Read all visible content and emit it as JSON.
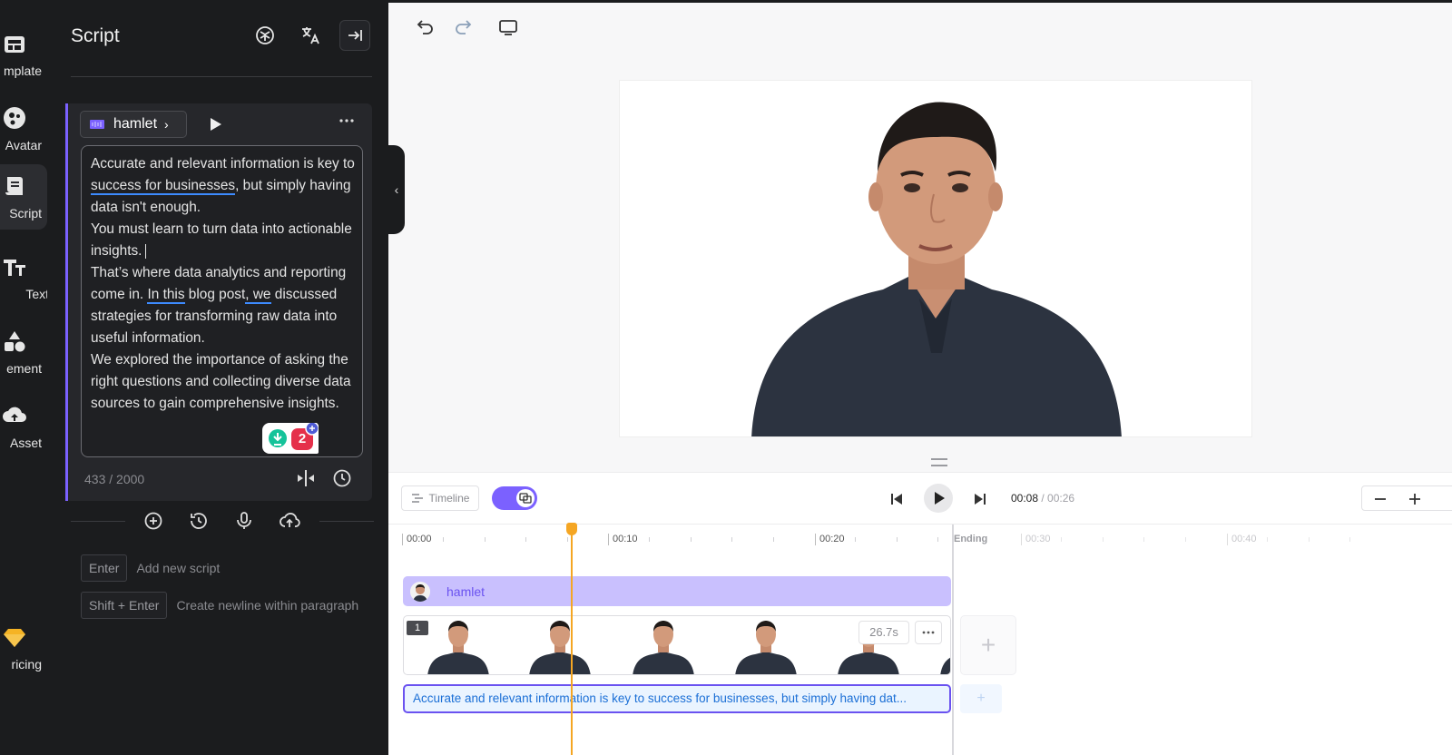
{
  "rail": {
    "items": [
      {
        "label": "mplate",
        "icon": "template-icon"
      },
      {
        "label": "Avatar",
        "icon": "avatar-icon"
      },
      {
        "label": "Script",
        "icon": "script-icon"
      },
      {
        "label": "Text",
        "icon": "text-icon"
      },
      {
        "label": "ement",
        "icon": "element-icon"
      },
      {
        "label": "Asset",
        "icon": "upload-cloud-icon"
      },
      {
        "label": "ricing",
        "icon": "diamond-icon"
      }
    ]
  },
  "panel": {
    "title": "Script",
    "voice_name": "hamlet",
    "script_text": {
      "p1a": "Accurate and relevant information is key to ",
      "p1u": "success for businesses",
      "p1b": ", but simply having data isn't enough.",
      "p2": "You must learn to turn data into actionable insights.",
      "p3a": "That’s where data analytics and reporting come in. ",
      "p3u1": "In this",
      "p3b": " blog post",
      "p3u2": ", we",
      "p3c": " discussed strategies for transforming raw data into useful information.",
      "p4": "We explored the importance of asking the right questions and collecting diverse data sources to gain comprehensive insights."
    },
    "grammar_count": "2",
    "char_count": "433 / 2000",
    "hints": [
      {
        "key": "Enter",
        "text": "Add new script"
      },
      {
        "key": "Shift + Enter",
        "text": "Create newline within paragraph"
      }
    ]
  },
  "timeline": {
    "mode_label": "Timeline",
    "current_time": "00:08",
    "total_time": " / 00:26",
    "ticks": [
      "00:00",
      "00:10",
      "00:20",
      "00:30",
      "00:40"
    ],
    "ending_label": "Ending",
    "avatar_track_label": "hamlet",
    "scene_number": "1",
    "scene_duration": "26.7s",
    "subtitle_text": "Accurate and relevant information is key to success for businesses, but simply having dat..."
  },
  "colors": {
    "accent": "#7b61ff",
    "playhead": "#f5a623",
    "underline": "#3d8bff",
    "dark_panel": "#1b1c1e"
  }
}
